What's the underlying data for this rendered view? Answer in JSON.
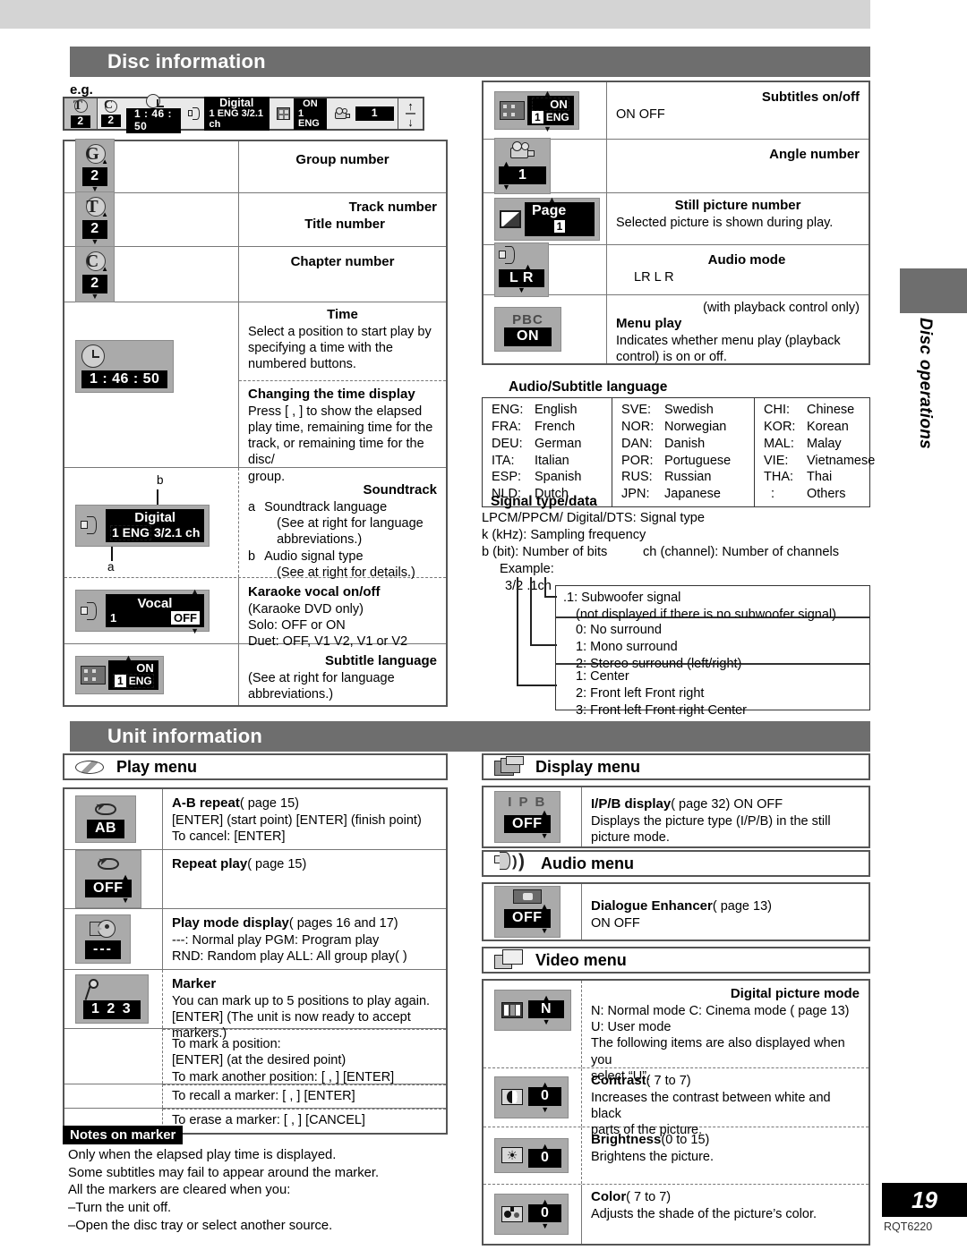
{
  "page": {
    "number": "19",
    "code": "RQT6220",
    "side_tab_label": "Disc operations",
    "eg_label": "e.g."
  },
  "sections": {
    "disc_information": "Disc information",
    "unit_information": "Unit information"
  },
  "osd_example": {
    "group_value": "2",
    "chapter_value": "2",
    "time_value": "1 : 46 : 50",
    "soundtrack_line1": "Digital",
    "soundtrack_line2": "1 ENG  3/2.1 ch",
    "subtitle_on": "ON",
    "subtitle_lang": "1  ENG",
    "angle_value": "1"
  },
  "disc_rows_left": [
    {
      "icon": "group-number-icon",
      "letter": "G",
      "value": "2",
      "title": "Group number",
      "title_align": "center",
      "body": []
    },
    {
      "icon": "title-number-icon",
      "letter": "T",
      "value": "2",
      "title": "Track number",
      "title2": "Title number",
      "title_align": "right",
      "body": []
    },
    {
      "icon": "chapter-number-icon",
      "letter": "C",
      "value": "2",
      "title": "Chapter number",
      "title_align": "center",
      "body": []
    }
  ],
  "time_row": {
    "icon": "clock-icon",
    "value": "1 : 46 : 50",
    "title": "Time",
    "body": "Select a position to start play by specifying a time with the numbered buttons.",
    "sub_title": "Changing the time display",
    "sub_body": "Press [     ] to show the elapsed play time, remaining time for the track, or remaining time for the disc/ group.",
    "sub_body_bracket": "Press [    ,     ] to show the elapsed",
    "sub_body_l2": "play time, remaining time for the",
    "sub_body_l3": "track, or remaining time for the disc/",
    "sub_body_l4": "group."
  },
  "soundtrack_row": {
    "label_a": "a",
    "label_b": "b",
    "chip_line1": "Digital",
    "chip_line2_a": "1 ENG",
    "chip_line2_b": "3/2.1 ch",
    "title": "Soundtrack",
    "items": [
      {
        "key": "a",
        "l1": "Soundtrack language",
        "l2": "(See     at right for language",
        "l3": "abbreviations.)"
      },
      {
        "key": "b",
        "l1": "Audio signal type",
        "l2": "(See     at right for details.)"
      }
    ]
  },
  "karaoke_row": {
    "chip_title": "Vocal",
    "chip_left": "1",
    "chip_right": "OFF",
    "title": "Karaoke vocal on/off",
    "l1": "(Karaoke DVD only)",
    "l2": "Solo:  OFF or ON",
    "l3": "Duet:  OFF, V1   V2, V1 or V2"
  },
  "subtitle_lang_row": {
    "chip_on": "ON",
    "chip_num": "1",
    "chip_lang": "ENG",
    "title": "Subtitle language",
    "l1": "(See     at right for language",
    "l2": "abbreviations.)"
  },
  "disc_rows_right": [
    {
      "icon": "subtitles-onoff-icon",
      "chip_on": "ON",
      "chip_num": "1",
      "chip_lang": "ENG",
      "title": "Subtitles on/off",
      "body": "ON       OFF"
    },
    {
      "icon": "angle-number-icon",
      "value": "1",
      "title": "Angle number",
      "body": ""
    },
    {
      "icon": "still-picture-icon",
      "chip_title": "Page",
      "chip_value": "1",
      "title": "Still picture number",
      "body": "Selected picture is shown during play."
    },
    {
      "icon": "audio-mode-icon",
      "value": "L R",
      "title": "Audio mode",
      "body": "LR      L      R"
    },
    {
      "icon": "menu-play-icon",
      "label": "PBC",
      "value": "ON",
      "note": "(with playback control only)",
      "title": "Menu play",
      "body": "Indicates whether menu play (playback control) is on or off."
    }
  ],
  "language_table": {
    "heading": "Audio/Subtitle language",
    "columns": [
      [
        {
          "code": "ENG:",
          "name": "English"
        },
        {
          "code": "FRA:",
          "name": "French"
        },
        {
          "code": "DEU:",
          "name": "German"
        },
        {
          "code": "ITA:",
          "name": "Italian"
        },
        {
          "code": "ESP:",
          "name": "Spanish"
        },
        {
          "code": "NLD:",
          "name": "Dutch"
        }
      ],
      [
        {
          "code": "SVE:",
          "name": "Swedish"
        },
        {
          "code": "NOR:",
          "name": "Norwegian"
        },
        {
          "code": "DAN:",
          "name": "Danish"
        },
        {
          "code": "POR:",
          "name": "Portuguese"
        },
        {
          "code": "RUS:",
          "name": "Russian"
        },
        {
          "code": "JPN:",
          "name": "Japanese"
        }
      ],
      [
        {
          "code": "CHI:",
          "name": "Chinese"
        },
        {
          "code": "KOR:",
          "name": "Korean"
        },
        {
          "code": "MAL:",
          "name": "Malay"
        },
        {
          "code": "VIE:",
          "name": "Vietnamese"
        },
        {
          "code": "THA:",
          "name": "Thai"
        },
        {
          "code": "  :",
          "name": "Others"
        }
      ]
    ]
  },
  "signal": {
    "heading": "Signal type/data",
    "l1": "LPCM/PPCM/      Digital/DTS:  Signal type",
    "l2": "k (kHz): Sampling frequency",
    "l3a": "b (bit):  Number of bits",
    "l3b": "ch (channel):  Number of channels",
    "l4": "Example:",
    "l5": "3/2 .1ch",
    "box1": [
      ".1:  Subwoofer signal",
      "(not displayed if there is no subwoofer signal)"
    ],
    "box2": [
      "0:  No surround",
      "1:  Mono surround",
      "2:  Stereo surround (left/right)"
    ],
    "box3": [
      "1:  Center",
      "2:  Front left   Front right",
      "3:  Front left   Front right   Center"
    ]
  },
  "play_menu": {
    "title": "Play menu",
    "rows": [
      {
        "icon": "ab-repeat-icon",
        "chip_value": "AB",
        "title": "A-B repeat",
        "ref": "(     page 15)",
        "l1": "[ENTER] (start point)      [ENTER] (finish point)",
        "l2": "To cancel:  [ENTER]"
      },
      {
        "icon": "repeat-play-icon",
        "chip_value": "OFF",
        "title": "Repeat play",
        "ref": "(     page 15)",
        "l1": "",
        "l2": ""
      },
      {
        "icon": "play-mode-icon",
        "chip_value": "---",
        "title": "Play mode display",
        "ref": "(     pages 16 and 17)",
        "l1": "---: Normal play          PGM: Program play",
        "l2": "RND: Random play   ALL: All group play(             )"
      },
      {
        "icon": "marker-icon",
        "chip_value": "1 2 3",
        "title": "Marker",
        "ref": "",
        "l1": "You can mark up to 5 positions to play again.",
        "l2": "[ENTER] (The unit is now ready to accept markers.)"
      }
    ],
    "marker_extra": [
      [
        "To mark a position:",
        "[ENTER] (at the desired point)",
        "To mark another position: [    ,     ]    [ENTER]"
      ],
      [
        "To recall a marker: [    ,     ]     [ENTER]"
      ],
      [
        "To erase a marker: [    ,     ]      [CANCEL]"
      ]
    ]
  },
  "notes_on_marker": {
    "heading": "Notes on marker",
    "lines": [
      "Only when the elapsed play time is displayed.",
      "Some subtitles may fail to appear around the marker.",
      "All the markers are cleared when you:",
      "–Turn the unit off.",
      "–Open the disc tray or select another source."
    ]
  },
  "display_menu": {
    "title": "Display menu",
    "row": {
      "icon": "ipb-display-icon",
      "chip_label": "I P B",
      "chip_value": "OFF",
      "title": "I/P/B display",
      "ref": "(     page 32)      ON        OFF",
      "l1": "Displays the picture type (I/P/B) in the still",
      "l2": "picture mode."
    }
  },
  "audio_menu": {
    "title": "Audio menu",
    "row": {
      "icon": "dialogue-enhancer-icon",
      "chip_value": "OFF",
      "title": "Dialogue Enhancer",
      "ref": "(     page 13)",
      "l1": "ON       OFF"
    }
  },
  "video_menu": {
    "title": "Video menu",
    "rows": [
      {
        "icon": "digital-picture-mode-icon",
        "chip_value": "N",
        "title": "Digital picture mode",
        "title_align": "right",
        "l1": "N: Normal mode    C: Cinema mode (     page 13)",
        "l2": "U: User mode",
        "l3": "The following items are also displayed when you",
        "l4": "select “U”."
      },
      {
        "icon": "contrast-icon",
        "chip_value": "0",
        "title": "Contrast",
        "ref": "(    7 to     7)",
        "l1": "Increases the contrast between white and black",
        "l2": "parts of the picture."
      },
      {
        "icon": "brightness-icon",
        "chip_value": "0",
        "title": "Brightness",
        "ref": "(0 to      15)",
        "l1": "Brightens the picture.",
        "l2": ""
      },
      {
        "icon": "color-icon",
        "chip_value": "0",
        "title": "Color",
        "ref": "(    7 to     7)",
        "l1": "Adjusts the shade of the picture’s color.",
        "l2": ""
      }
    ]
  }
}
